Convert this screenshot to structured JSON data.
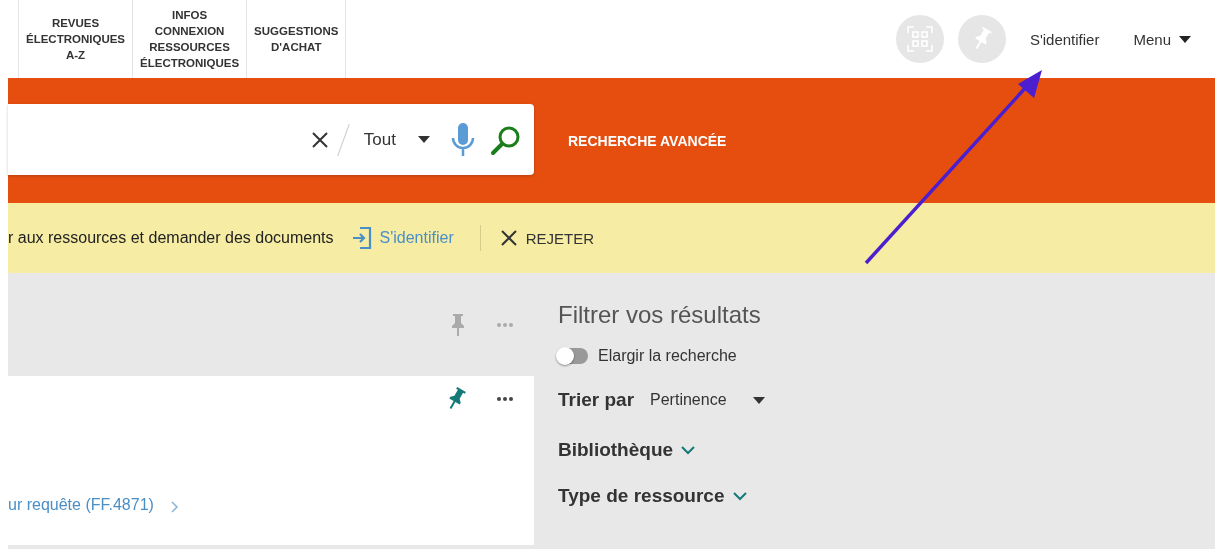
{
  "header": {
    "nav_links": [
      "REVUES\nÉLECTRONIQUES\nA-Z",
      "INFOS\nCONNEXION\nRESSOURCES\nÉLECTRONIQUES",
      "SUGGESTIONS\nD'ACHAT"
    ],
    "sign_in": "S'identifier",
    "menu": "Menu"
  },
  "search": {
    "scope": "Tout",
    "advanced": "RECHERCHE AVANCÉE"
  },
  "banner": {
    "message": "r aux ressources et demander des documents",
    "sign_in": "S'identifier",
    "dismiss": "REJETER"
  },
  "results": [
    {
      "kind": "toolbar",
      "pinned": false
    },
    {
      "kind": "record",
      "pinned": true,
      "link": "ur requête (FF.4871)"
    }
  ],
  "filters": {
    "title": "Filtrer vos résultats",
    "expand": {
      "label": "Elargir la recherche",
      "on": false
    },
    "sort": {
      "label": "Trier par",
      "value": "Pertinence"
    },
    "facets": [
      {
        "label": "Bibliothèque",
        "expanded": false
      },
      {
        "label": "Type de ressource",
        "expanded": false
      }
    ]
  }
}
